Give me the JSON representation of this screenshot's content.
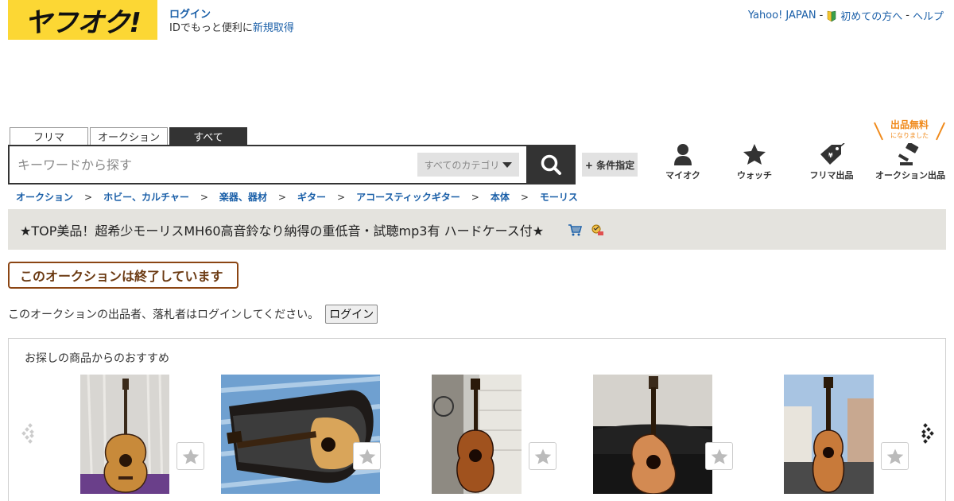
{
  "header": {
    "logo_text": "ヤフオク!",
    "login_label": "ログイン",
    "login_sub": "IDでもっと便利に",
    "register_label": "新規取得",
    "top_links": {
      "yahoo": "Yahoo! JAPAN",
      "sep1": "-",
      "beginner": "初めての方へ",
      "sep2": "-",
      "help": "ヘルプ"
    }
  },
  "search": {
    "tabs": [
      {
        "label": "フリマ"
      },
      {
        "label": "オークション"
      },
      {
        "label": "すべて"
      }
    ],
    "placeholder": "キーワードから探す",
    "category": "すべてのカテゴリ",
    "condition_label": "+ 条件指定"
  },
  "nav_icons": {
    "myauction": "マイオク",
    "watch": "ウォッチ",
    "flea_listing": "フリマ出品",
    "auction_listing": "オークション出品",
    "free_badge": "出品無料",
    "free_badge_sub": "になりました"
  },
  "breadcrumb": [
    "オークション",
    "ホビー、カルチャー",
    "楽器、器材",
    "ギター",
    "アコースティックギター",
    "本体",
    "モーリス"
  ],
  "breadcrumb_sep": ">",
  "item": {
    "title": "★TOP美品！超希少モーリスMH60高音鈴なり納得の重低音・試聴mp3有 ハードケース付★"
  },
  "status": {
    "ended": "このオークションは終了しています",
    "login_note": "このオークションの出品者、落札者はログインしてください。",
    "login_button": "ログイン"
  },
  "recommend": {
    "title": "お探しの商品からのおすすめ"
  },
  "colors": {
    "brand_yellow": "#fcd734",
    "link_blue": "#1a5fa8",
    "ended_brown": "#8b4513",
    "free_orange": "#f08a1b"
  }
}
